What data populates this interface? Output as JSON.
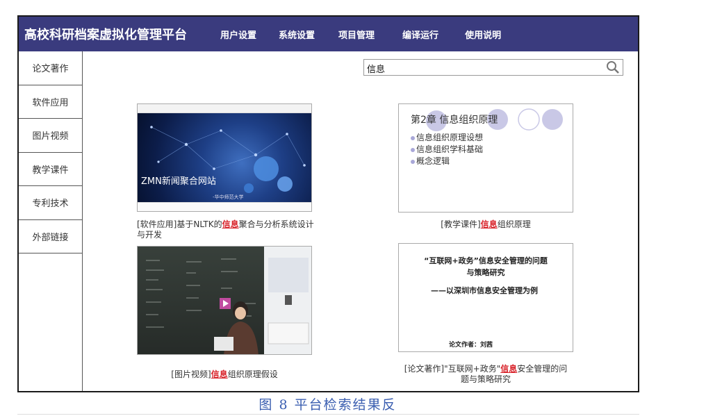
{
  "header": {
    "app_title": "高校科研档案虚拟化管理平台",
    "nav": [
      "用户设置",
      "系统设置",
      "项目管理",
      "编译运行",
      "使用说明"
    ]
  },
  "sidebar": {
    "items": [
      "论文著作",
      "软件应用",
      "图片视频",
      "教学课件",
      "专利技术",
      "外部链接"
    ]
  },
  "search": {
    "value": "信息",
    "icon": "search-icon"
  },
  "results": [
    {
      "thumb_title": "ZMN新闻聚合网站",
      "thumb_subtitle": "-华中师范大学",
      "caption_before": "[软件应用]基于NLTK的",
      "caption_highlight": "信息",
      "caption_after": "聚合与分析系统设计与开发"
    },
    {
      "slide_title": "第2章 信息组织原理",
      "slide_bullets": [
        "信息组织原理设想",
        "信息组织学科基础",
        "概念逻辑"
      ],
      "caption_before": "[教学课件]",
      "caption_highlight": "信息",
      "caption_after": "组织原理"
    },
    {
      "caption_before": "[图片视频]",
      "caption_highlight": "信息",
      "caption_after": "组织原理假设"
    },
    {
      "doc_line1": "“互联网+政务”信息安全管理的问题",
      "doc_line2": "与策略研究",
      "doc_line3": "——以深圳市信息安全管理为例",
      "doc_author": "论文作者：刘茜",
      "caption_before": "[论文著作]\"互联网+政务\"",
      "caption_highlight": "信息",
      "caption_after": "安全管理的问题与策略研究"
    }
  ],
  "figure_caption": "图 8 平台检索结果反",
  "colors": {
    "topbar": "#3a3b7e",
    "highlight": "#d8232a",
    "caption": "#3a5eb0"
  }
}
